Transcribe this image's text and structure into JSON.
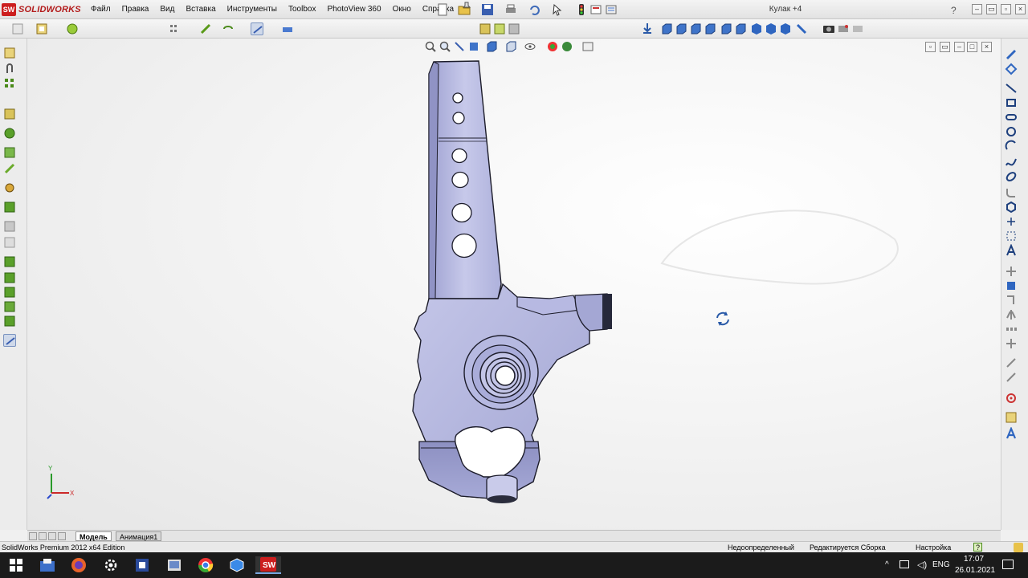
{
  "app": {
    "logo_badge": "SW",
    "logo_text": "SOLIDWORKS",
    "doc_title": "Кулак +4"
  },
  "menu": [
    "Файл",
    "Правка",
    "Вид",
    "Вставка",
    "Инструменты",
    "Toolbox",
    "PhotoView 360",
    "Окно",
    "Справка"
  ],
  "tabs": {
    "model": "Модель",
    "animation": "Анимация1"
  },
  "triad": {
    "y": "Y",
    "x": "X"
  },
  "status": {
    "edition": "SolidWorks Premium 2012 x64 Edition",
    "definition": "Недоопределенный",
    "editing": "Редактируется Сборка",
    "settings": "Настройка",
    "help": "?"
  },
  "taskbar": {
    "lang": "ENG",
    "time": "17:07",
    "date": "26.01.2021"
  },
  "colors": {
    "part_face": "#b2b4dd",
    "part_edge": "#1c1c2a",
    "accent": "#cc1e1e"
  }
}
